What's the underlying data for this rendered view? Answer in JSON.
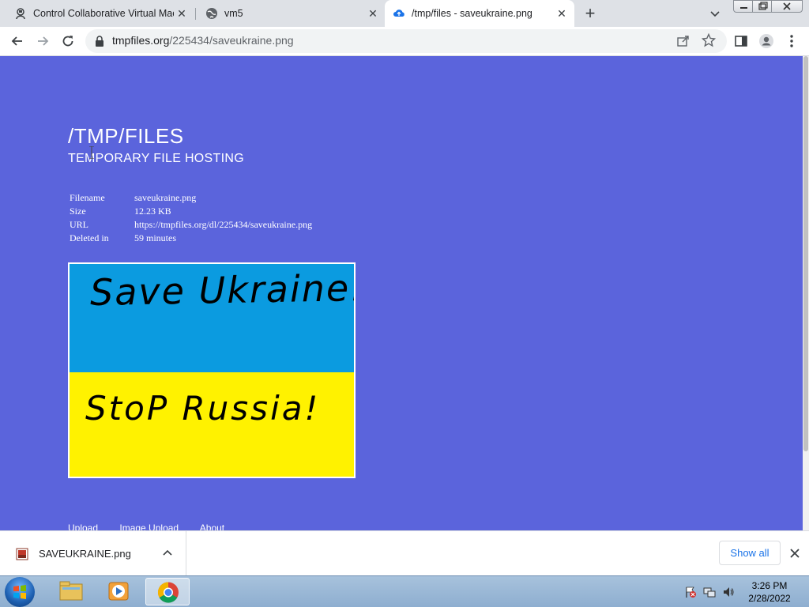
{
  "browser": {
    "tabs": [
      {
        "title": "Control Collaborative Virtual Mac",
        "icon": "virtual-machine-icon",
        "active": false
      },
      {
        "title": "vm5",
        "icon": "globe-icon",
        "active": false
      },
      {
        "title": "/tmp/files - saveukraine.png",
        "icon": "cloud-upload-icon",
        "active": true
      }
    ],
    "url_domain": "tmpfiles.org",
    "url_path": "/225434/saveukraine.png"
  },
  "page": {
    "title": "/TMP/FILES",
    "subtitle": "TEMPORARY FILE HOSTING",
    "file_info": [
      {
        "key": "Filename",
        "value": "saveukraine.png"
      },
      {
        "key": "Size",
        "value": "12.23 KB"
      },
      {
        "key": "URL",
        "value": "https://tmpfiles.org/dl/225434/saveukraine.png"
      },
      {
        "key": "Deleted in",
        "value": "59 minutes"
      }
    ],
    "preview": {
      "top_text": "Save Ukraine!",
      "bottom_text": "StoP Russia!",
      "top_color": "#0b9be0",
      "bottom_color": "#fff200"
    },
    "footer_links": [
      "Upload",
      "Image Upload",
      "About"
    ],
    "background_color": "#5b64dc"
  },
  "download_shelf": {
    "file_name": "SAVEUKRAINE.png",
    "show_all_label": "Show all"
  },
  "taskbar": {
    "time": "3:26 PM",
    "date": "2/28/2022"
  }
}
